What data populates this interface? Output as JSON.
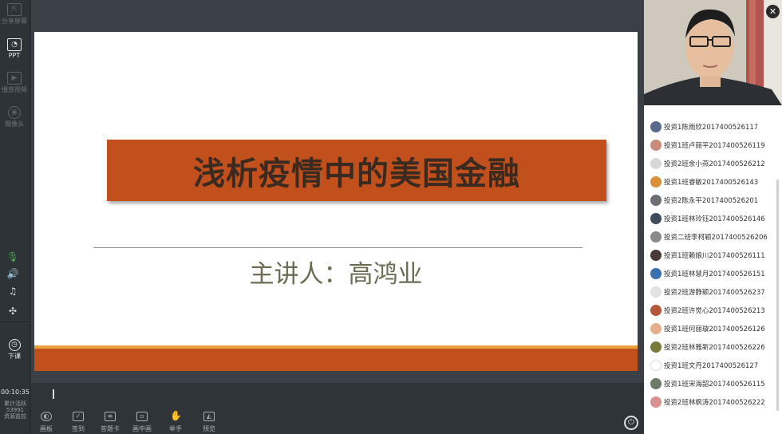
{
  "sidebar": {
    "items": [
      {
        "label": "分享屏幕",
        "icon": "share-screen-icon",
        "active": false
      },
      {
        "label": "PPT",
        "icon": "ppt-icon",
        "active": true
      },
      {
        "label": "播放视频",
        "icon": "play-video-icon",
        "active": false
      },
      {
        "label": "摄像头",
        "icon": "camera-icon",
        "active": false
      }
    ],
    "controls": [
      "microphone-icon",
      "speaker-icon",
      "music-icon",
      "fullscreen-icon"
    ],
    "end_class_label": "下课"
  },
  "slide": {
    "title": "浅析疫情中的美国金融",
    "presenter": "主讲人：高鸿业",
    "colors": {
      "title_bar": "#c2501d",
      "stripe": "#e9a23b",
      "title_text": "#3a2a20",
      "presenter_text": "#6d6d55"
    }
  },
  "status": {
    "timer": "00:10:35",
    "stat_line1": "累计活跃",
    "stat_value": "53991",
    "stat_line2": "资源监控"
  },
  "toolbar": {
    "items": [
      {
        "label": "画板",
        "icon": "palette-icon"
      },
      {
        "label": "签到",
        "icon": "checkin-icon"
      },
      {
        "label": "答题卡",
        "icon": "answer-card-icon"
      },
      {
        "label": "画中画",
        "icon": "picture-in-picture-icon"
      },
      {
        "label": "举手",
        "icon": "raise-hand-icon"
      },
      {
        "label": "预览",
        "icon": "preview-icon"
      }
    ]
  },
  "users": [
    {
      "name": "投资1陈雨欣2017400526117",
      "color": "#5b6b8c"
    },
    {
      "name": "投资1班卢丽平2017400526119",
      "color": "#c98b7b"
    },
    {
      "name": "投资2班余小燕2017400526212",
      "color": "#d8d8d8"
    },
    {
      "name": "投资1班睿敏2017400526143",
      "color": "#d9903a"
    },
    {
      "name": "投资2陈永平2017400526201",
      "color": "#6b6f74"
    },
    {
      "name": "投资1班林玲钰2017400526146",
      "color": "#3f4a5a"
    },
    {
      "name": "投资二班李柯颖2017400526206",
      "color": "#8a8a8a"
    },
    {
      "name": "投资1班赖娘川2017400526111",
      "color": "#4a3a3a"
    },
    {
      "name": "投资1班林慧月2017400526151",
      "color": "#3b6fb0"
    },
    {
      "name": "投资2班游静颖2017400526237",
      "color": "#e2e2e2"
    },
    {
      "name": "投资2班许觉心2017400526213",
      "color": "#b5553a"
    },
    {
      "name": "投资1班何丽璇2017400526126",
      "color": "#e3b08c"
    },
    {
      "name": "投资2班林雅新2017400526226",
      "color": "#7a7a3a"
    },
    {
      "name": "投资1班文丹2017400526127",
      "color": "#ffffff"
    },
    {
      "name": "投资1班宋海韶2017400526115",
      "color": "#6d7a6a"
    },
    {
      "name": "投资2班林枫涛2017400526222",
      "color": "#d89090"
    }
  ]
}
